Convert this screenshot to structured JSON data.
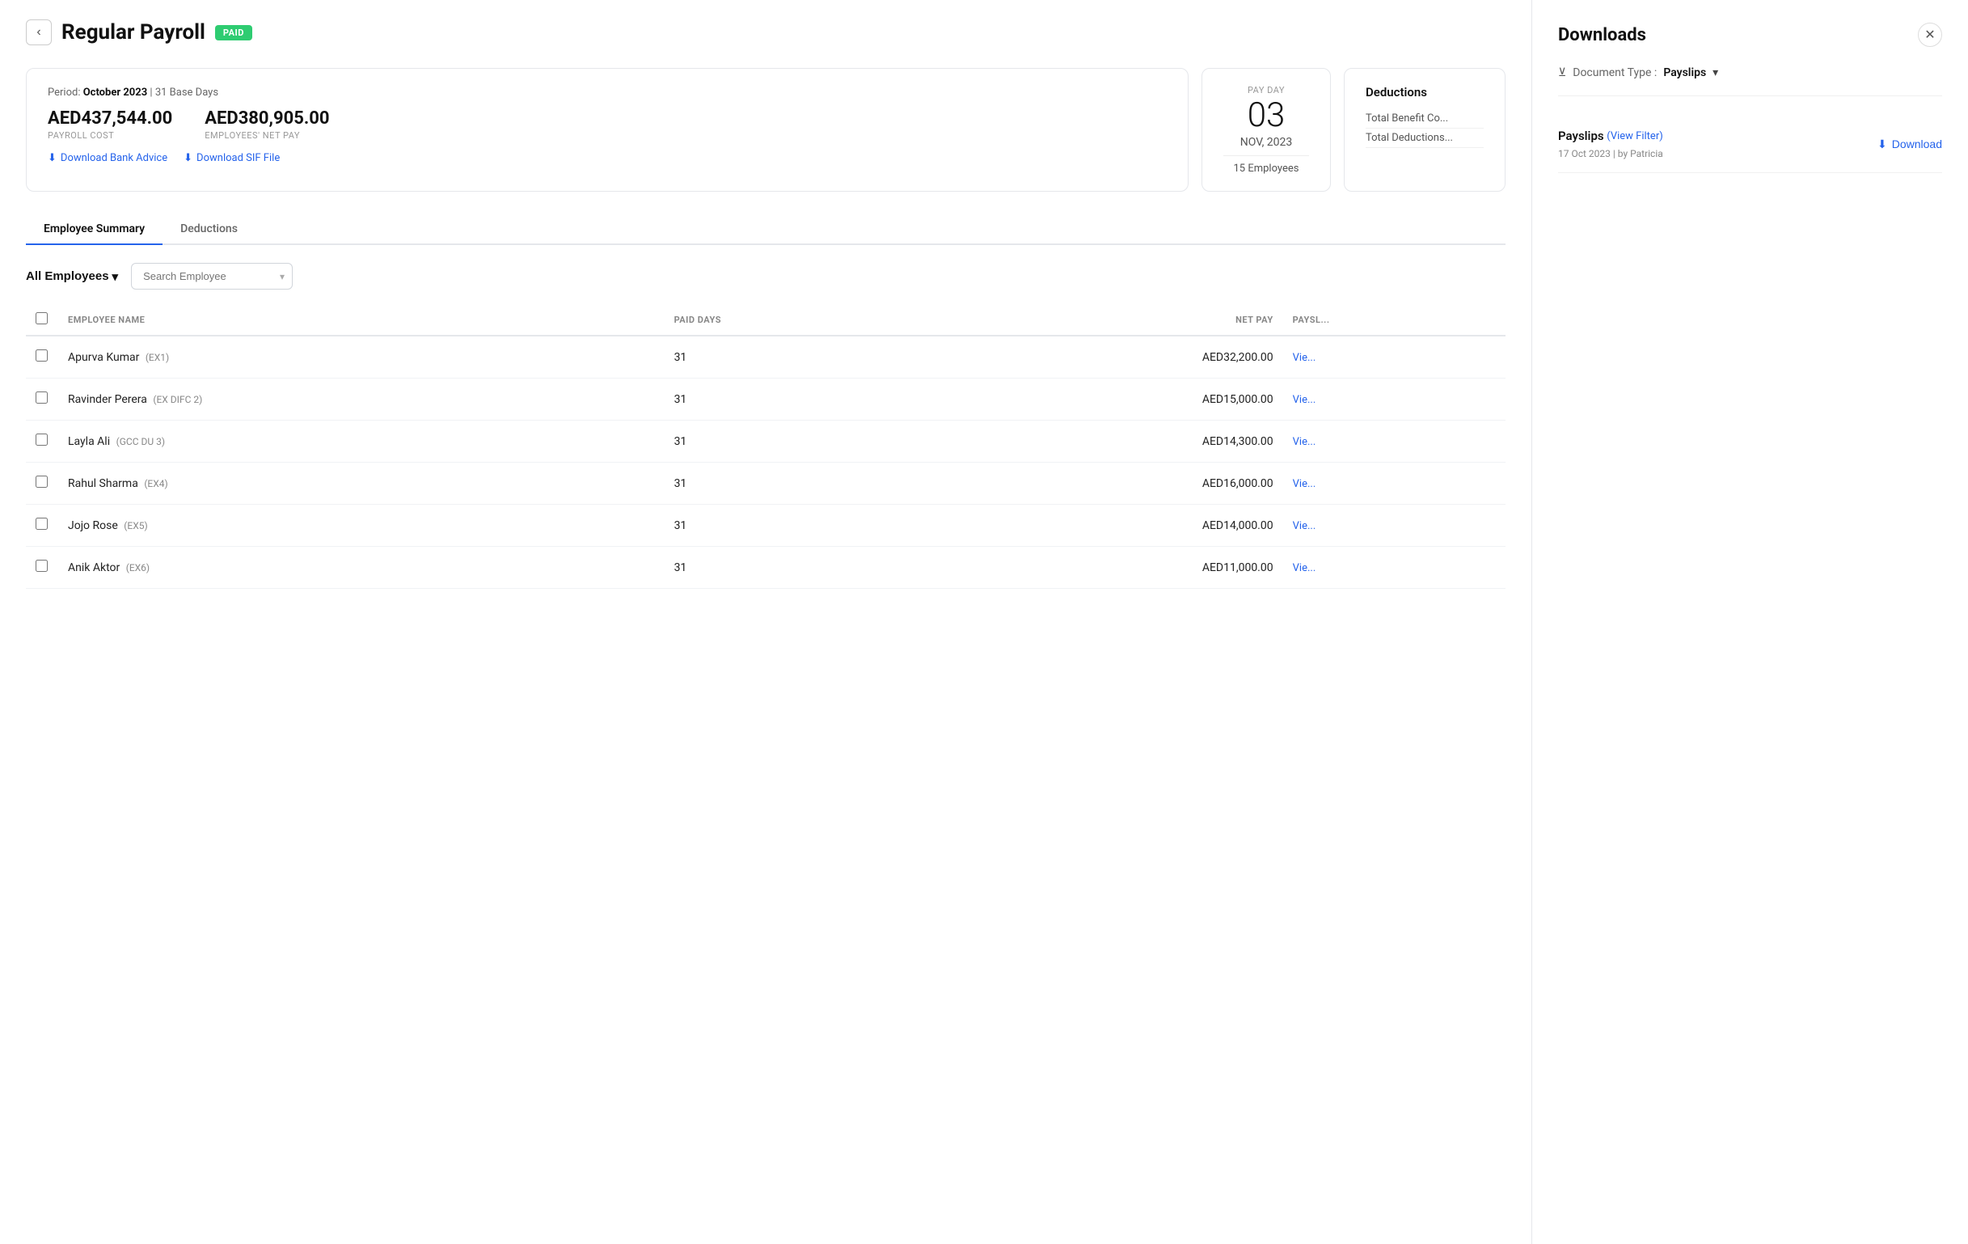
{
  "header": {
    "back_label": "‹",
    "title": "Regular Payroll",
    "badge": "PAID"
  },
  "summary": {
    "period_label": "Period:",
    "period_value": "October 2023",
    "base_days": "31 Base Days",
    "payroll_cost": "AED437,544.00",
    "payroll_cost_label": "PAYROLL COST",
    "net_pay": "AED380,905.00",
    "net_pay_label": "EMPLOYEES' NET PAY",
    "download_bank": "Download Bank Advice",
    "download_sif": "Download SIF File"
  },
  "pay_day": {
    "label": "PAY DAY",
    "day": "03",
    "month": "NOV, 2023",
    "employees": "15 Employees"
  },
  "deductions": {
    "title": "Deductions",
    "rows": [
      {
        "label": "Total Benefit Co...",
        "value": ""
      },
      {
        "label": "Total Deductions...",
        "value": ""
      }
    ]
  },
  "tabs": [
    {
      "id": "employee-summary",
      "label": "Employee Summary",
      "active": true
    },
    {
      "id": "deductions",
      "label": "Deductions",
      "active": false
    }
  ],
  "filters": {
    "all_employees": "All Employees",
    "search_placeholder": "Search Employee"
  },
  "table": {
    "columns": [
      {
        "id": "name",
        "label": "EMPLOYEE NAME"
      },
      {
        "id": "paid_days",
        "label": "PAID DAYS"
      },
      {
        "id": "net_pay",
        "label": "NET PAY",
        "align": "right"
      },
      {
        "id": "payslip",
        "label": "PAYSL..."
      }
    ],
    "rows": [
      {
        "name": "Apurva Kumar",
        "code": "(EX1)",
        "paid_days": "31",
        "net_pay": "AED32,200.00",
        "payslip": "Vie..."
      },
      {
        "name": "Ravinder Perera",
        "code": "(EX DIFC 2)",
        "paid_days": "31",
        "net_pay": "AED15,000.00",
        "payslip": "Vie..."
      },
      {
        "name": "Layla Ali",
        "code": "(GCC DU 3)",
        "paid_days": "31",
        "net_pay": "AED14,300.00",
        "payslip": "Vie..."
      },
      {
        "name": "Rahul Sharma",
        "code": "(EX4)",
        "paid_days": "31",
        "net_pay": "AED16,000.00",
        "payslip": "Vie..."
      },
      {
        "name": "Jojo Rose",
        "code": "(EX5)",
        "paid_days": "31",
        "net_pay": "AED14,000.00",
        "payslip": "Vie..."
      },
      {
        "name": "Anik Aktor",
        "code": "(EX6)",
        "paid_days": "31",
        "net_pay": "AED11,000.00",
        "payslip": "Vie..."
      }
    ]
  },
  "downloads_panel": {
    "title": "Downloads",
    "doc_type_prefix": "Document Type :",
    "doc_type_value": "Payslips",
    "payslips_section": {
      "title": "Payslips",
      "view_filter": "(View Filter)",
      "date": "17 Oct 2023",
      "by": "by Patricia",
      "download_label": "Download"
    }
  }
}
